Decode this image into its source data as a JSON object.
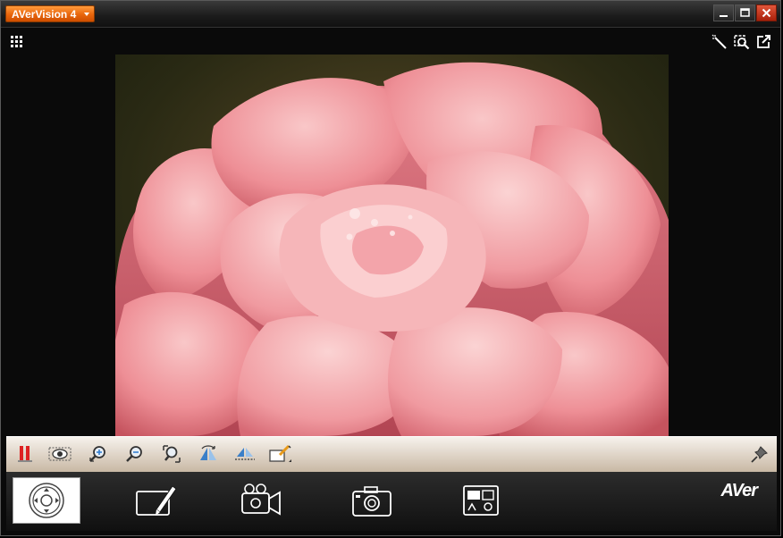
{
  "window": {
    "title": "AVerVision 4",
    "controls": [
      "minimize-icon",
      "maximize-icon",
      "close-icon"
    ]
  },
  "topbar": {
    "left_icon": "grid-menu-icon",
    "right_icons": [
      "annotation-pen-icon",
      "zoom-region-icon",
      "external-window-icon"
    ]
  },
  "toolbar": {
    "tools": [
      "freeze-icon",
      "visual-mode-icon",
      "zoom-in-icon",
      "zoom-out-icon",
      "zoom-reset-icon",
      "rotate-icon",
      "mirror-icon",
      "annotation-mode-icon"
    ],
    "pin_icon": "pin-icon"
  },
  "tabs": [
    {
      "icon": "camera-control-icon",
      "active": true
    },
    {
      "icon": "drawing-tablet-icon",
      "active": false
    },
    {
      "icon": "video-record-icon",
      "active": false
    },
    {
      "icon": "capture-photo-icon",
      "active": false
    },
    {
      "icon": "gallery-icon",
      "active": false
    }
  ],
  "brand": {
    "logo_text": "AVer"
  },
  "colors": {
    "accent": "#e8650c",
    "close": "#c8301a"
  }
}
